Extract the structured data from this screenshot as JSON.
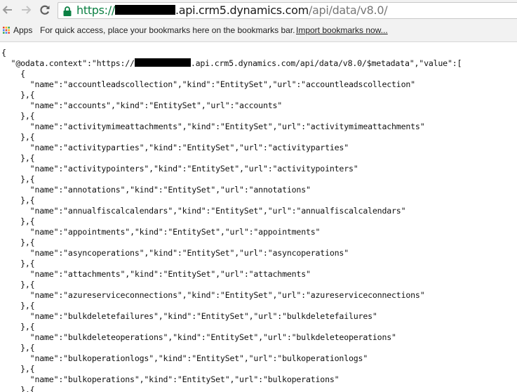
{
  "browser": {
    "url_scheme": "https://",
    "url_host": ".api.crm5.dynamics.com",
    "url_path": "/api/data/v8.0/"
  },
  "bookmarks": {
    "apps_label": "Apps",
    "hint": "For quick access, place your bookmarks here on the bookmarks bar.",
    "import_link": "Import bookmarks now..."
  },
  "json": {
    "open_brace": "{",
    "context_key": "  \"@odata.context\":\"https://",
    "context_tail": ".api.crm5.dynamics.com/api/data/v8.0/$metadata\",\"value\":[",
    "first_open": "    {",
    "separator": "    },{",
    "entities": [
      {
        "name": "accountleadscollection",
        "kind": "EntitySet",
        "url": "accountleadscollection"
      },
      {
        "name": "accounts",
        "kind": "EntitySet",
        "url": "accounts"
      },
      {
        "name": "activitymimeattachments",
        "kind": "EntitySet",
        "url": "activitymimeattachments"
      },
      {
        "name": "activityparties",
        "kind": "EntitySet",
        "url": "activityparties"
      },
      {
        "name": "activitypointers",
        "kind": "EntitySet",
        "url": "activitypointers"
      },
      {
        "name": "annotations",
        "kind": "EntitySet",
        "url": "annotations"
      },
      {
        "name": "annualfiscalcalendars",
        "kind": "EntitySet",
        "url": "annualfiscalcalendars"
      },
      {
        "name": "appointments",
        "kind": "EntitySet",
        "url": "appointments"
      },
      {
        "name": "asyncoperations",
        "kind": "EntitySet",
        "url": "asyncoperations"
      },
      {
        "name": "attachments",
        "kind": "EntitySet",
        "url": "attachments"
      },
      {
        "name": "azureserviceconnections",
        "kind": "EntitySet",
        "url": "azureserviceconnections"
      },
      {
        "name": "bulkdeletefailures",
        "kind": "EntitySet",
        "url": "bulkdeletefailures"
      },
      {
        "name": "bulkdeleteoperations",
        "kind": "EntitySet",
        "url": "bulkdeleteoperations"
      },
      {
        "name": "bulkoperationlogs",
        "kind": "EntitySet",
        "url": "bulkoperationlogs"
      },
      {
        "name": "bulkoperations",
        "kind": "EntitySet",
        "url": "bulkoperations"
      }
    ]
  }
}
